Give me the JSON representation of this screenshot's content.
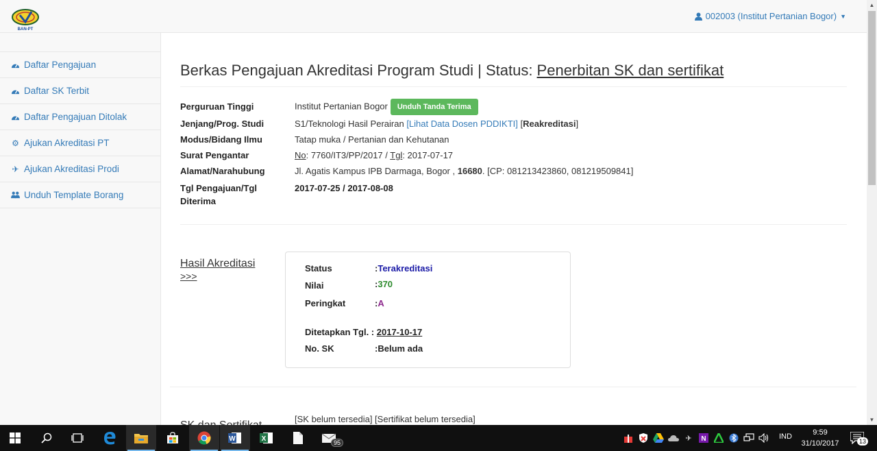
{
  "header": {
    "user_menu": "002003 (Institut Pertanian Bogor)"
  },
  "sidebar": {
    "items": [
      {
        "label": "Daftar Pengajuan",
        "icon": "dashboard-icon"
      },
      {
        "label": "Daftar SK Terbit",
        "icon": "dashboard-icon"
      },
      {
        "label": "Daftar Pengajuan Ditolak",
        "icon": "dashboard-icon"
      },
      {
        "label": "Ajukan Akreditasi PT",
        "icon": "gear-icon"
      },
      {
        "label": "Ajukan Akreditasi Prodi",
        "icon": "plane-icon"
      },
      {
        "label": "Unduh Template Borang",
        "icon": "users-icon"
      }
    ]
  },
  "main": {
    "title_prefix": "Berkas Pengajuan Akreditasi Program Studi | Status: ",
    "title_status": "Penerbitan SK dan sertifikat",
    "info": {
      "pt_label": "Perguruan Tinggi",
      "pt_value": "Institut Pertanian Bogor",
      "download_button": "Unduh Tanda Terima",
      "jenjang_label": "Jenjang/Prog. Studi",
      "jenjang_value": "S1/Teknologi Hasil Perairan ",
      "jenjang_link": "[Lihat Data Dosen PDDIKTI]",
      "jenjang_type_open": " [",
      "jenjang_type": "Reakreditasi",
      "jenjang_type_close": "]",
      "modus_label": "Modus/Bidang Ilmu",
      "modus_value": "Tatap muka / Pertanian dan Kehutanan",
      "surat_label": "Surat Pengantar",
      "surat_no_label": "No",
      "surat_no_value": ": 7760/IT3/PP/2017 / ",
      "surat_tgl_label": "Tgl",
      "surat_tgl_value": ": 2017-07-17",
      "alamat_label": "Alamat/Narahubung",
      "alamat_value": "Jl. Agatis Kampus IPB Darmaga, Bogor , ",
      "alamat_postcode": "16680",
      "alamat_cp": ". [CP: 081213423860, 081219509841]",
      "tgl_label": "Tgl Pengajuan/Tgl Diterima",
      "tgl_value": "2017-07-25 / 2017-08-08"
    },
    "hasil": {
      "title_line1": "Hasil Akreditasi",
      "title_line2": ">>>",
      "status_label": "Status",
      "status_value": "Terakreditasi",
      "nilai_label": "Nilai",
      "nilai_value": "370",
      "peringkat_label": "Peringkat",
      "peringkat_value": "A",
      "ditetapkan_label": "Ditetapkan Tgl. :",
      "ditetapkan_value": "2017-10-17",
      "nosk_label": "No. SK",
      "nosk_value": "Belum ada",
      "colon": ": "
    },
    "sk": {
      "title": "SK dan Sertifikat",
      "value": "[SK belum tersedia] [Sertifikat belum tersedia]"
    }
  },
  "taskbar": {
    "apps": [
      "start-icon",
      "search-icon",
      "task-view-icon",
      "edge-icon",
      "file-explorer-icon",
      "store-icon",
      "chrome-icon",
      "word-icon",
      "excel-icon",
      "notepad-icon",
      "mail-icon"
    ],
    "mail_badge": "95",
    "language": "IND",
    "time": "9:59",
    "date": "31/10/2017",
    "notification_count": "13"
  },
  "colors": {
    "link": "#337ab7",
    "button_green": "#5cb85c",
    "status_blue": "#1a1aa6",
    "nilai_green": "#2e8b2e",
    "peringkat_purple": "#8e2a8e"
  }
}
